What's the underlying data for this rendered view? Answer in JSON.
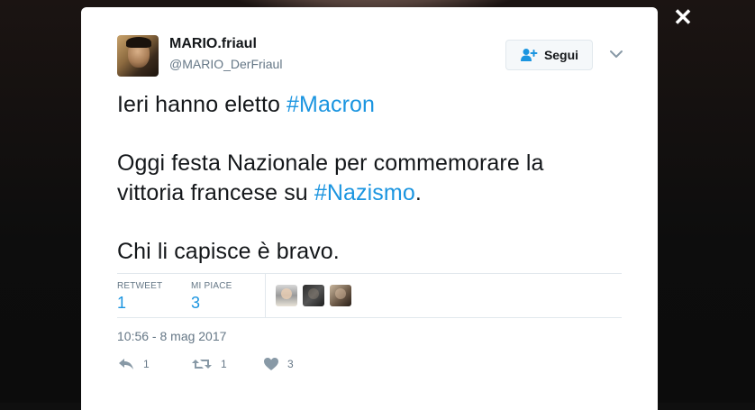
{
  "lightbox": {
    "close_label": "✕"
  },
  "tweet": {
    "author": {
      "name": "MARIO.friaul",
      "handle": "@MARIO_DerFriaul"
    },
    "follow_label": "Segui",
    "text": {
      "line1_prefix": "Ieri hanno eletto ",
      "line1_hashtag": "#Macron",
      "line2": "Oggi festa Nazionale per commemorare la",
      "line3_prefix": "vittoria francese su ",
      "line3_hashtag": "#Nazismo",
      "line3_suffix": ".",
      "line4": "Chi li capisce è bravo."
    },
    "stats": {
      "retweets_label": "RETWEET",
      "retweets": "1",
      "likes_label": "MI PIACE",
      "likes": "3"
    },
    "timestamp": "10:56 - 8 mag 2017",
    "actions": {
      "reply": "1",
      "retweet": "1",
      "like": "3"
    }
  },
  "colors": {
    "link": "#1b95e0",
    "text": "#14171a",
    "muted": "#657786",
    "border": "#e1e8ed"
  },
  "icons": [
    "close-icon",
    "follow-user-icon",
    "caret-down-icon",
    "reply-icon",
    "retweet-icon",
    "heart-icon"
  ]
}
